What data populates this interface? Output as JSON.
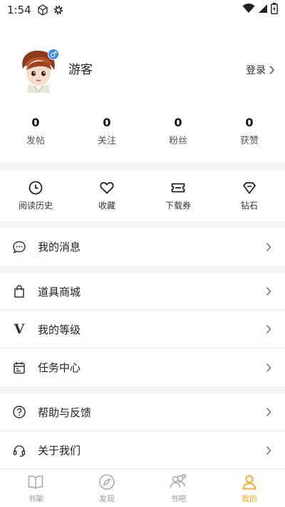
{
  "status_bar": {
    "time": "1:54"
  },
  "profile": {
    "username": "游客",
    "gender_symbol": "♂",
    "login_label": "登录"
  },
  "stats": [
    {
      "value": "0",
      "label": "发帖"
    },
    {
      "value": "0",
      "label": "关注"
    },
    {
      "value": "0",
      "label": "粉丝"
    },
    {
      "value": "0",
      "label": "获赞"
    }
  ],
  "quick_actions": [
    {
      "label": "阅读历史",
      "icon": "clock-icon"
    },
    {
      "label": "收藏",
      "icon": "heart-icon"
    },
    {
      "label": "下载券",
      "icon": "ticket-icon"
    },
    {
      "label": "钻石",
      "icon": "diamond-icon"
    }
  ],
  "menu": {
    "messages": {
      "label": "我的消息",
      "icon": "chat-bubble-icon"
    },
    "shop": {
      "label": "道具商城",
      "icon": "shopping-bag-icon"
    },
    "level": {
      "label": "我的等级",
      "icon": "v-level-icon",
      "glyph": "V"
    },
    "tasks": {
      "label": "任务中心",
      "icon": "calendar-icon"
    },
    "help": {
      "label": "帮助与反馈",
      "icon": "question-circle-icon"
    },
    "about": {
      "label": "关于我们",
      "icon": "headset-icon"
    }
  },
  "tabs": [
    {
      "label": "书架",
      "icon": "book-icon",
      "active": false
    },
    {
      "label": "发现",
      "icon": "compass-icon",
      "active": false
    },
    {
      "label": "书吧",
      "icon": "community-icon",
      "active": false
    },
    {
      "label": "我的",
      "icon": "person-icon",
      "active": true
    }
  ],
  "colors": {
    "accent": "#f5a623",
    "gender_badge": "#3b8ee8",
    "background": "#f5f5f5"
  }
}
